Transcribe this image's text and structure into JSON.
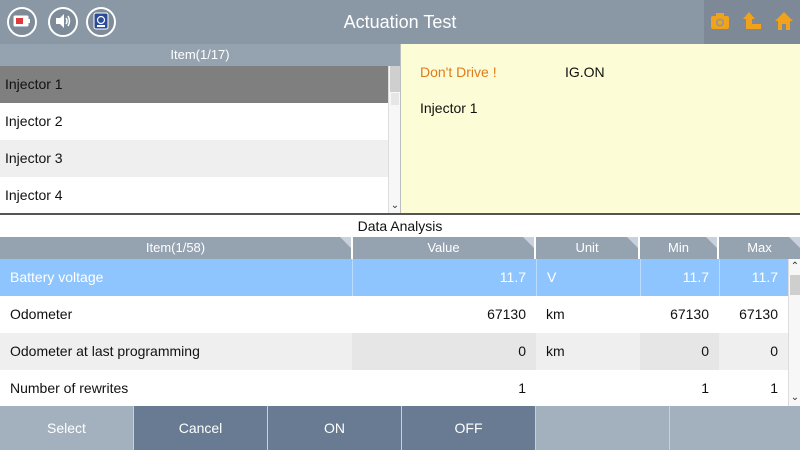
{
  "header": {
    "title": "Actuation Test"
  },
  "icons": {
    "battery": "battery-icon",
    "sound": "speaker-icon",
    "vci": "vci-icon",
    "camera": "camera-icon",
    "back": "back-arrow-icon",
    "home": "home-icon",
    "accent": "#f0a21a"
  },
  "item_list": {
    "header": "Item(1/17)",
    "items": [
      "Injector 1",
      "Injector 2",
      "Injector 3",
      "Injector 4"
    ]
  },
  "info": {
    "warning": "Don't Drive !",
    "condition": "IG.ON",
    "selected_item": "Injector 1",
    "warning_color": "#e07b1b"
  },
  "data_analysis": {
    "title": "Data Analysis",
    "columns": [
      "Item(1/58)",
      "Value",
      "Unit",
      "Min",
      "Max"
    ],
    "rows": [
      {
        "item": "Battery voltage",
        "value": "11.7",
        "unit": "V",
        "min": "11.7",
        "max": "11.7"
      },
      {
        "item": "Odometer",
        "value": "67130",
        "unit": "km",
        "min": "67130",
        "max": "67130"
      },
      {
        "item": "Odometer at last programming",
        "value": "0",
        "unit": "km",
        "min": "0",
        "max": "0"
      },
      {
        "item": "Number of rewrites",
        "value": "1",
        "unit": "",
        "min": "1",
        "max": "1"
      }
    ]
  },
  "buttons": {
    "select": "Select",
    "cancel": "Cancel",
    "on": "ON",
    "off": "OFF"
  }
}
